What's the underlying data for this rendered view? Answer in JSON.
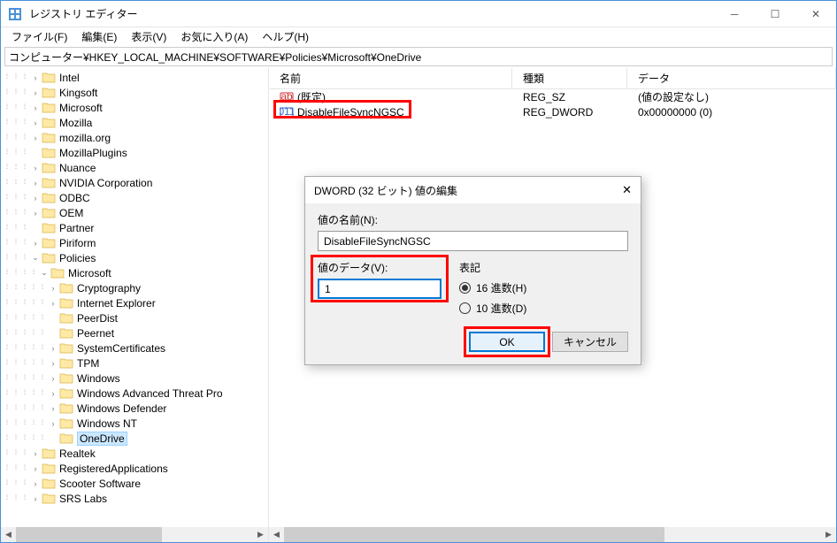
{
  "window": {
    "title": "レジストリ エディター",
    "min": "—",
    "max": "☐",
    "close": "✕"
  },
  "menu": {
    "file": "ファイル(F)",
    "edit": "編集(E)",
    "view": "表示(V)",
    "favorites": "お気に入り(A)",
    "help": "ヘルプ(H)"
  },
  "address": "コンピューター¥HKEY_LOCAL_MACHINE¥SOFTWARE¥Policies¥Microsoft¥OneDrive",
  "tree": [
    {
      "indent": 3,
      "chev": ">",
      "label": "Intel"
    },
    {
      "indent": 3,
      "chev": ">",
      "label": "Kingsoft"
    },
    {
      "indent": 3,
      "chev": ">",
      "label": "Microsoft"
    },
    {
      "indent": 3,
      "chev": ">",
      "label": "Mozilla"
    },
    {
      "indent": 3,
      "chev": ">",
      "label": "mozilla.org"
    },
    {
      "indent": 3,
      "chev": "",
      "label": "MozillaPlugins"
    },
    {
      "indent": 3,
      "chev": ">",
      "label": "Nuance"
    },
    {
      "indent": 3,
      "chev": ">",
      "label": "NVIDIA Corporation"
    },
    {
      "indent": 3,
      "chev": ">",
      "label": "ODBC"
    },
    {
      "indent": 3,
      "chev": ">",
      "label": "OEM"
    },
    {
      "indent": 3,
      "chev": "",
      "label": "Partner"
    },
    {
      "indent": 3,
      "chev": ">",
      "label": "Piriform"
    },
    {
      "indent": 3,
      "chev": "v",
      "label": "Policies"
    },
    {
      "indent": 4,
      "chev": "v",
      "label": "Microsoft"
    },
    {
      "indent": 5,
      "chev": ">",
      "label": "Cryptography"
    },
    {
      "indent": 5,
      "chev": ">",
      "label": "Internet Explorer"
    },
    {
      "indent": 5,
      "chev": "",
      "label": "PeerDist"
    },
    {
      "indent": 5,
      "chev": "",
      "label": "Peernet"
    },
    {
      "indent": 5,
      "chev": ">",
      "label": "SystemCertificates"
    },
    {
      "indent": 5,
      "chev": ">",
      "label": "TPM"
    },
    {
      "indent": 5,
      "chev": ">",
      "label": "Windows"
    },
    {
      "indent": 5,
      "chev": ">",
      "label": "Windows Advanced Threat Pro"
    },
    {
      "indent": 5,
      "chev": ">",
      "label": "Windows Defender"
    },
    {
      "indent": 5,
      "chev": ">",
      "label": "Windows NT"
    },
    {
      "indent": 5,
      "chev": "",
      "label": "OneDrive",
      "selected": true
    },
    {
      "indent": 3,
      "chev": ">",
      "label": "Realtek"
    },
    {
      "indent": 3,
      "chev": ">",
      "label": "RegisteredApplications"
    },
    {
      "indent": 3,
      "chev": ">",
      "label": "Scooter Software"
    },
    {
      "indent": 3,
      "chev": ">",
      "label": "SRS Labs"
    }
  ],
  "list": {
    "columns": {
      "name": "名前",
      "type": "種類",
      "data": "データ"
    },
    "rows": [
      {
        "icon": "sz",
        "name": "(既定)",
        "type": "REG_SZ",
        "data": "(値の設定なし)"
      },
      {
        "icon": "dw",
        "name": "DisableFileSyncNGSC",
        "type": "REG_DWORD",
        "data": "0x00000000 (0)"
      }
    ]
  },
  "dialog": {
    "title": "DWORD (32 ビット) 値の編集",
    "name_label": "値の名前(N):",
    "name_value": "DisableFileSyncNGSC",
    "data_label": "値のデータ(V):",
    "data_value": "1",
    "base_label": "表記",
    "base_hex": "16 進数(H)",
    "base_dec": "10 進数(D)",
    "ok": "OK",
    "cancel": "キャンセル"
  }
}
